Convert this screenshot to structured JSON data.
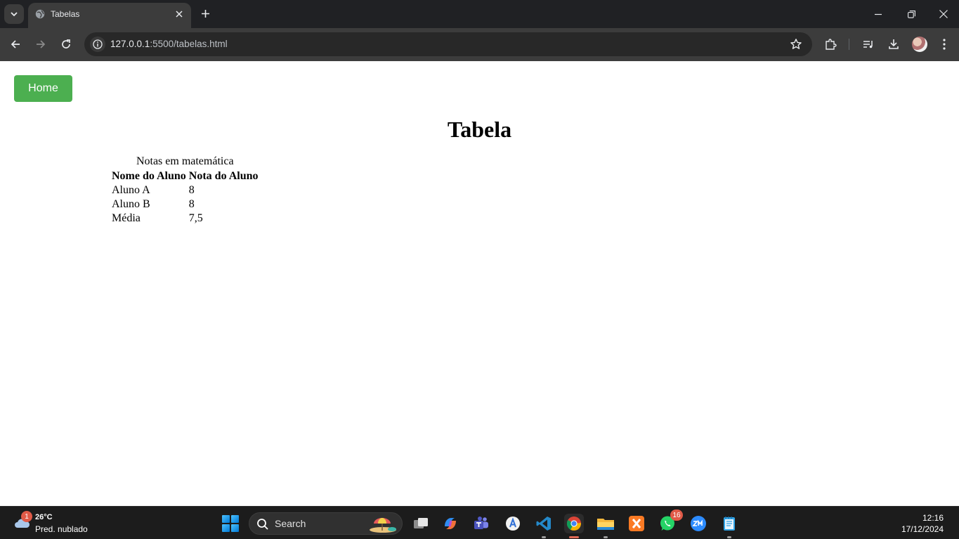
{
  "browser": {
    "tab": {
      "title": "Tabelas"
    },
    "address_bar": {
      "url_host": "127.0.0.1",
      "url_rest": ":5500/tabelas.html"
    }
  },
  "page": {
    "home_button": "Home",
    "title": "Tabela",
    "table": {
      "caption": "Notas em matemática",
      "headers": [
        "Nome do Aluno",
        "Nota do Aluno"
      ],
      "rows": [
        [
          "Aluno A",
          "8"
        ],
        [
          "Aluno B",
          "8"
        ],
        [
          "Média",
          "7,5"
        ]
      ]
    },
    "colors": {
      "home_button_bg": "#4caf50",
      "home_button_text": "#ffffff"
    }
  },
  "taskbar": {
    "weather": {
      "badge": "1",
      "temperature": "26°C",
      "condition": "Pred. nublado"
    },
    "search_label": "Search",
    "whatsapp_badge": "16",
    "clock": {
      "time": "12:16",
      "date": "17/12/2024"
    }
  }
}
